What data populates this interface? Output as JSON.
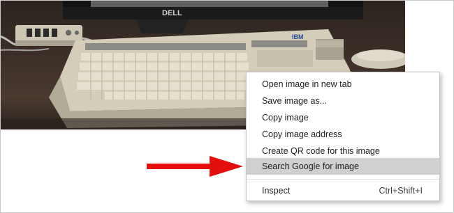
{
  "photo": {
    "subject": "keyboard-photo",
    "brand_logo_monitor": "DELL",
    "brand_logo_keyboard": "IBM"
  },
  "context_menu": {
    "items": [
      {
        "label": "Open image in new tab",
        "shortcut": ""
      },
      {
        "label": "Save image as...",
        "shortcut": ""
      },
      {
        "label": "Copy image",
        "shortcut": ""
      },
      {
        "label": "Copy image address",
        "shortcut": ""
      },
      {
        "label": "Create QR code for this image",
        "shortcut": ""
      },
      {
        "label": "Search Google for image",
        "shortcut": "",
        "highlighted": true
      }
    ],
    "inspect": {
      "label": "Inspect",
      "shortcut": "Ctrl+Shift+I"
    }
  },
  "colors": {
    "arrow": "#e30e0e",
    "highlight": "#d0d0d0",
    "menu_text": "#202124"
  },
  "icons": {
    "annotation": "red-arrow-icon"
  }
}
